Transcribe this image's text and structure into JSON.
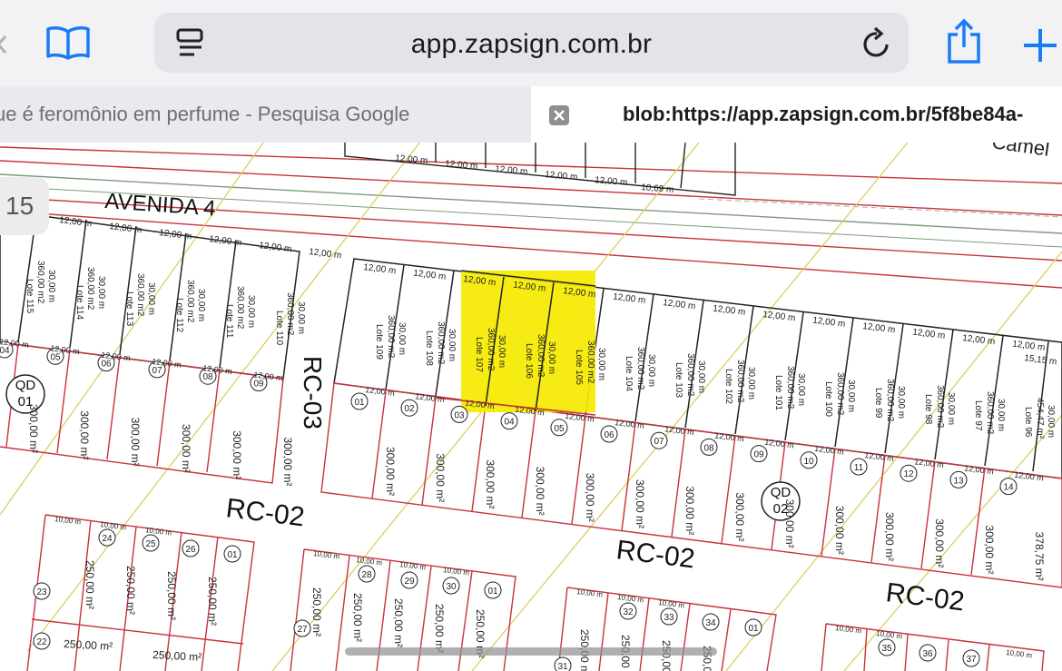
{
  "browser": {
    "url": "app.zapsign.com.br",
    "tabs": [
      {
        "label": "ue é feromônio em perfume - Pesquisa Google"
      },
      {
        "label": "blob:https://app.zapsign.com.br/5f8be84a-"
      }
    ]
  },
  "map": {
    "page_number": "15",
    "streets": {
      "avenida": "AVENIDA 4",
      "rc03": "RC-03",
      "rc02_a": "RC-02",
      "rc02_b": "RC-02",
      "rc02_c": "RC-02",
      "camelo": "Camel"
    },
    "quadras": {
      "qd01": {
        "name": "QD",
        "num": "01"
      },
      "qd02": {
        "name": "QD",
        "num": "02"
      }
    },
    "lots_qd01": [
      "04",
      "05",
      "06",
      "07",
      "08",
      "09"
    ],
    "lots_qd02": [
      "01",
      "02",
      "03",
      "04",
      "05",
      "06",
      "07",
      "08",
      "09",
      "10",
      "11",
      "12",
      "13",
      "14"
    ],
    "lower_lots": [
      "24",
      "25",
      "26",
      "01",
      "23",
      "28",
      "29",
      "30",
      "01",
      "27",
      "32",
      "33",
      "34",
      "01",
      "31",
      "35",
      "36",
      "37",
      "22"
    ],
    "measures": {
      "front": "12,00 m",
      "depth": "30,00 m",
      "area360": "360,00 m2",
      "area300": "300,00 m²",
      "area250": "250,00 m²",
      "front10": "10,00 m",
      "last_area": "454,47 m²",
      "last_area2": "378,75 m²",
      "last_front": "15,15 m",
      "top_frag": "10,69 m"
    },
    "upper_lots": [
      "Lote 115",
      "Lote 114",
      "Lote 113",
      "Lote 112",
      "Lote 111",
      "Lote 110",
      "Lote 109",
      "Lote 108",
      "Lote 107",
      "Lote 106",
      "Lote 105",
      "Lote 104",
      "Lote 103",
      "Lote 102",
      "Lote 101",
      "Lote 100",
      "Lote 99",
      "Lote 98",
      "Lote 97",
      "Lote 96"
    ]
  },
  "colors": {
    "highlight": "#f5ea00",
    "lot_red": "#c8323c",
    "road_yellow": "#d8d060"
  }
}
